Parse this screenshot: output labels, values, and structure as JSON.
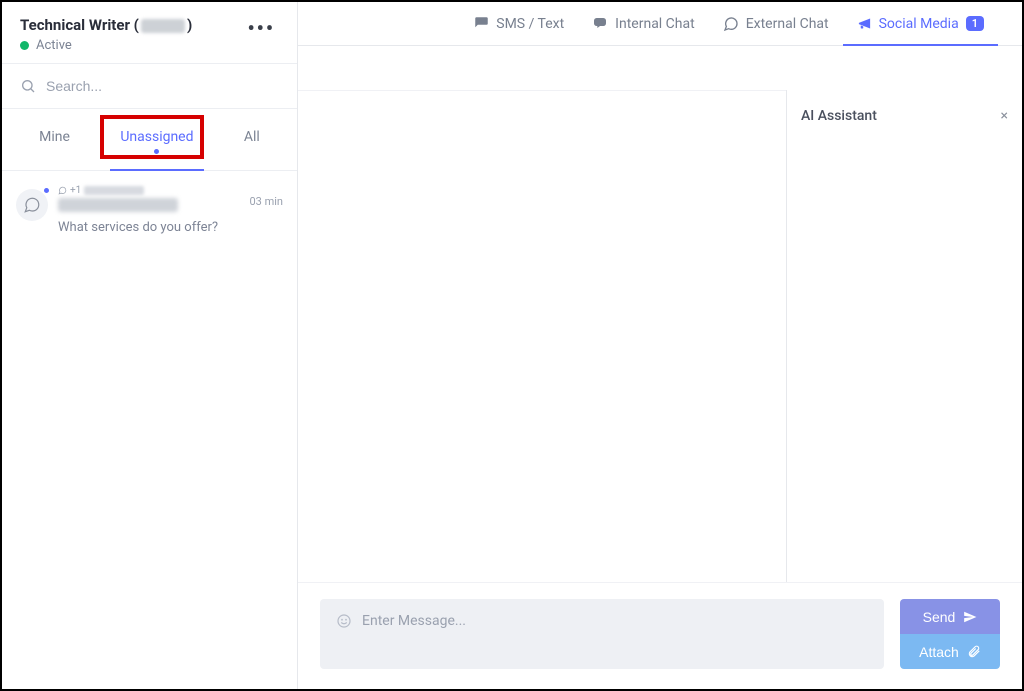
{
  "sidebar": {
    "user_title_prefix": "Technical Writer (",
    "user_title_suffix": ")",
    "status_label": "Active",
    "search_placeholder": "Search...",
    "filter_tabs": {
      "mine": "Mine",
      "unassigned": "Unassigned",
      "all": "All"
    },
    "conversation": {
      "phone_prefix": "+1",
      "preview": "What services do you offer?",
      "time": "03 min"
    }
  },
  "channels": {
    "sms": "SMS / Text",
    "internal": "Internal Chat",
    "external": "External Chat",
    "social": "Social Media",
    "social_badge": "1"
  },
  "ai_panel": {
    "title": "AI Assistant",
    "close": "×"
  },
  "composer": {
    "placeholder": "Enter Message...",
    "send_label": "Send",
    "attach_label": "Attach"
  }
}
